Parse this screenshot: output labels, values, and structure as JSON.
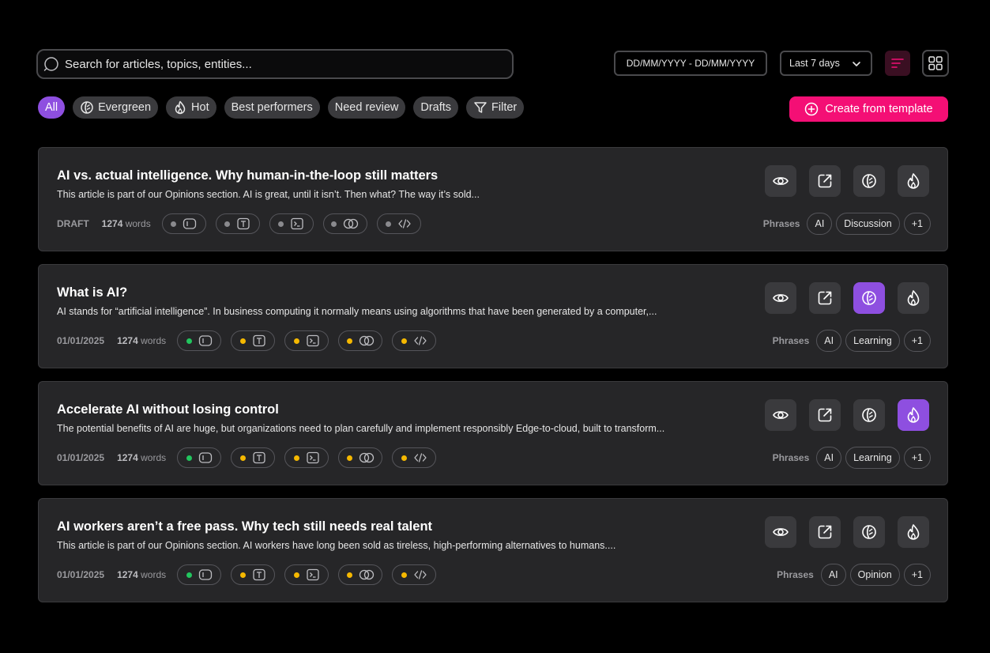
{
  "search": {
    "placeholder": "Search for articles, topics, entities..."
  },
  "date_range": {
    "value": "DD/MM/YYYY - DD/MM/YYYY"
  },
  "period": {
    "value": "Last 7 days"
  },
  "filters": [
    {
      "label": "All",
      "active": true,
      "icon": ""
    },
    {
      "label": "Evergreen",
      "active": false,
      "icon": "leaf-icon"
    },
    {
      "label": "Hot",
      "active": false,
      "icon": "flame-icon"
    },
    {
      "label": "Best performers",
      "active": false,
      "icon": ""
    },
    {
      "label": "Need review",
      "active": false,
      "icon": ""
    },
    {
      "label": "Drafts",
      "active": false,
      "icon": ""
    },
    {
      "label": "Filter",
      "active": false,
      "icon": "filter-icon"
    }
  ],
  "create_button": {
    "label": "Create from template"
  },
  "colors": {
    "accent": "#8e4fe0",
    "brand": "#f40f75",
    "green": "#22c55e",
    "yellow": "#f5b800",
    "grey": "#8a8a8e"
  },
  "articles": [
    {
      "title": "AI vs. actual intelligence. Why human-in-the-loop still matters",
      "description": "This article is part of our Opinions section. AI is great, until it isn’t. Then what? The way it’s sold...",
      "status": "DRAFT",
      "word_count": "1274",
      "words_label": "words",
      "tool_status": [
        "grey",
        "grey",
        "grey",
        "grey",
        "grey"
      ],
      "evergreen_active": false,
      "hot_active": false,
      "phrases_label": "Phrases",
      "tags": [
        "AI",
        "Discussion",
        "+1"
      ]
    },
    {
      "title": "What is AI?",
      "description": "AI stands for “artificial intelligence”. In business computing it normally means using algorithms that have been generated by a computer,...",
      "status": "01/01/2025",
      "word_count": "1274",
      "words_label": "words",
      "tool_status": [
        "green",
        "yellow",
        "yellow",
        "yellow",
        "yellow"
      ],
      "evergreen_active": true,
      "hot_active": false,
      "phrases_label": "Phrases",
      "tags": [
        "AI",
        "Learning",
        "+1"
      ]
    },
    {
      "title": "Accelerate AI without losing control",
      "description": "The potential benefits of AI are huge, but organizations need to plan carefully and implement responsibly Edge-to-cloud, built to transform...",
      "status": "01/01/2025",
      "word_count": "1274",
      "words_label": "words",
      "tool_status": [
        "green",
        "yellow",
        "yellow",
        "yellow",
        "yellow"
      ],
      "evergreen_active": false,
      "hot_active": true,
      "phrases_label": "Phrases",
      "tags": [
        "AI",
        "Learning",
        "+1"
      ]
    },
    {
      "title": "AI workers aren’t a free pass. Why tech still needs real talent",
      "description": "This article is part of our Opinions section. AI workers have long been sold as tireless, high-performing alternatives to humans....",
      "status": "01/01/2025",
      "word_count": "1274",
      "words_label": "words",
      "tool_status": [
        "green",
        "yellow",
        "yellow",
        "yellow",
        "yellow"
      ],
      "evergreen_active": false,
      "hot_active": false,
      "phrases_label": "Phrases",
      "tags": [
        "AI",
        "Opinion",
        "+1"
      ]
    }
  ]
}
